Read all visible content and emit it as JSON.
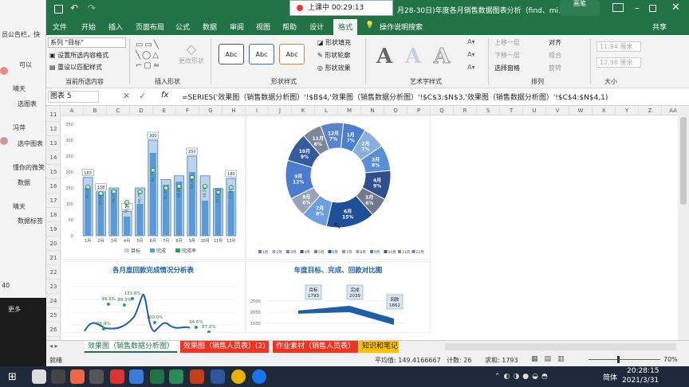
{
  "left_panel": {
    "rows": [
      "员公告栏，快",
      "可以",
      "晴天",
      "选图表",
      "冯萍",
      "选中图表",
      "懂你的微笑",
      "数据",
      "晴天",
      "数据标签",
      "40",
      "更多"
    ]
  },
  "titlebar": {
    "title": "月28-30日)年度各月销售数据图表分析（find、mi...",
    "meeting_badge": "上课中 00:29:13",
    "pen_label": "画笔"
  },
  "menu": {
    "items": [
      "文件",
      "开始",
      "插入",
      "页面布局",
      "公式",
      "数据",
      "审阅",
      "视图",
      "帮助",
      "设计",
      "格式"
    ],
    "search": "操作说明搜索",
    "share": "共享"
  },
  "ribbon": {
    "series_select": "系列 \"目标\"",
    "format_selection": "设置所选内容格式",
    "reset_style": "重设以匹配样式",
    "group_current": "当前所选内容",
    "group_insert_shapes": "插入形状",
    "change_shape": "更改形状",
    "style_abc": "Abc",
    "shape_fill": "形状填充",
    "shape_outline": "形状轮廓",
    "shape_effects": "形状效果",
    "group_shape_styles": "形状样式",
    "art_letter": "A",
    "group_wordart": "艺术字样式",
    "bring_forward": "上移一层",
    "send_backward": "下移一层",
    "selection_pane": "选择窗格",
    "align": "对齐",
    "group": "组合",
    "rotate": "旋转",
    "group_arrange": "排列",
    "height": "11.94 厘米",
    "width": "12.96 厘米",
    "group_size": "大小"
  },
  "formula": {
    "name_box": "图表 5",
    "fx": "fx",
    "content": "=SERIES('效果图（销售数据分析图）'!$B$4,'效果图（销售数据分析图）'!$C$3:$N$3,'效果图（销售数据分析图）'!$C$4:$N$4,1)"
  },
  "columns": [
    "A",
    "B",
    "C",
    "D",
    "E",
    "F",
    "G",
    "H",
    "I",
    "J",
    "K",
    "L",
    "M",
    "N",
    "O",
    "P",
    "Q",
    "R",
    "S",
    "T",
    "U",
    "V",
    "W",
    "X",
    "Y",
    "Z",
    "AA"
  ],
  "rows": [
    "11",
    "12",
    "13",
    "14",
    "15",
    "16",
    "17",
    "18",
    "19",
    "20",
    "21",
    "22",
    "23",
    "24",
    "25",
    "26"
  ],
  "chart_data": [
    {
      "type": "bar",
      "categories": [
        "1月",
        "2月",
        "3月",
        "4月",
        "5月",
        "6月",
        "7月",
        "8月",
        "9月",
        "10月",
        "11月",
        "12月"
      ],
      "series": [
        {
          "name": "目标",
          "values": [
            183,
            138,
            150,
            76,
            150,
            300,
            176,
            188,
            250,
            188,
            148,
            180
          ]
        },
        {
          "name": "完成",
          "values": [
            150,
            135,
            145,
            60,
            100,
            260,
            160,
            170,
            200,
            110,
            150,
            140
          ]
        }
      ],
      "labels": [
        "183",
        "138",
        "",
        "76",
        "",
        "300",
        "",
        "",
        "250",
        "",
        "",
        "180"
      ],
      "rates": [
        "82.0%",
        "97.8%",
        "96.7%",
        "78.9%",
        "66.7%",
        "86.7%",
        "90.9%",
        "88.8%",
        "80.0%",
        "58.5%",
        "101.4%",
        "77.8%"
      ],
      "ylim": [
        0,
        350
      ],
      "yticks": [
        "350",
        "300",
        "250",
        "200",
        "150",
        "100",
        "50",
        "0"
      ],
      "legend": [
        "目标",
        "完成",
        "完成率"
      ],
      "legend_position": "bottom"
    },
    {
      "type": "pie",
      "categories": [
        "1月",
        "2月",
        "3月",
        "4月",
        "5月",
        "6月",
        "7月",
        "8月",
        "9月",
        "10月",
        "11月",
        "12月"
      ],
      "values": [
        7,
        7,
        8,
        9,
        6,
        15,
        8,
        6,
        12,
        9,
        6,
        7
      ],
      "labels": [
        "7%",
        "7%",
        "8%",
        "9%",
        "6%",
        "15%",
        "8%",
        "6%",
        "12%",
        "9%",
        "6%",
        "7%"
      ]
    },
    {
      "type": "line",
      "title": "各月度回款完成情况分析表",
      "labels": [
        "133.8%",
        "99.3%",
        "89.3%",
        "100.0%",
        "91.9%",
        "94.6%",
        "87.0%"
      ]
    },
    {
      "type": "area",
      "title": "年度目标、完成、回款对比图",
      "yticks": [
        "2500",
        "2000",
        "1500",
        "1000"
      ],
      "callouts": [
        {
          "name": "目标",
          "value": "1793"
        },
        {
          "name": "完成",
          "value": "2039"
        },
        {
          "name": "回款",
          "value": "1662"
        }
      ]
    }
  ],
  "tabs": [
    "效果图（销售数据分析图）",
    "效果图（销售人员表）(2)",
    "作业素材（销售人员表）",
    "知识和笔记"
  ],
  "status": {
    "ready": "就绪",
    "average": "平均值: 149.4166667",
    "count": "计数: 26",
    "sum": "求和: 1793",
    "zoom": "70%"
  },
  "taskbar": {
    "time": "20:28:15",
    "date": "2021/3/31",
    "lang": "简体"
  },
  "colors": {
    "excel_green": "#217346",
    "target_blue": "#bcd2ee",
    "done_blue": "#5b9bd5",
    "rate_green": "#2e9e5b",
    "donut_dark": "#2f4f8f"
  }
}
